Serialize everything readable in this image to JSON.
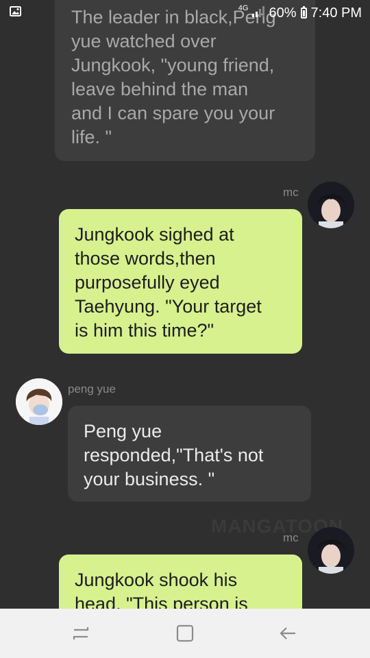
{
  "status_bar": {
    "network": "4G",
    "battery": "60%",
    "time": "7:40 PM",
    "notification_icon": "gallery-icon"
  },
  "messages": [
    {
      "sender": "",
      "side": "left",
      "text": "The leader in black,Peng\nyue watched over\nJungkook, \"young friend,\nleave behind the man\nand I can spare you your\nlife. \""
    },
    {
      "sender": "mc",
      "side": "right",
      "text": "Jungkook sighed at\nthose words,then\npurposefully eyed\nTaehyung. \"Your target\nis him this time?\""
    },
    {
      "sender": "peng yue",
      "side": "left",
      "text": "Peng yue\nresponded,\"That's not\nyour business. \""
    },
    {
      "sender": "mc",
      "side": "right",
      "text": "Jungkook shook his\nhead. \"This person is"
    }
  ],
  "watermark": "MANGATOON",
  "nav_bar": {
    "recents": "recent-apps-icon",
    "home": "home-icon",
    "back": "back-icon"
  }
}
